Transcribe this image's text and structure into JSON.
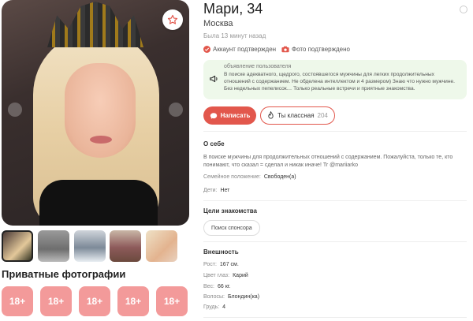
{
  "profile": {
    "name": "Мари, 34",
    "city": "Москва",
    "last_seen": "Была 13 минут назад",
    "badges": [
      {
        "label": "Аккаунт подтвержден",
        "color": "#e2574c"
      },
      {
        "label": "Фото подтверждено",
        "color": "#e2574c"
      }
    ]
  },
  "announcement": {
    "title": "объявление пользователя",
    "text": "В поиске адекватного, щедрого, состоявшегося мужчины для легких продолжительных отношений с содержанием. Не обделена интеллектом и 4 размером) Знаю что нужно мужчине. Без недельных пепелисок… Только реальные встречи и приятные знакомства."
  },
  "actions": {
    "write_label": "Написать",
    "like_label": "Ты классная",
    "like_count": "204"
  },
  "about": {
    "title": "О себе",
    "text": "В поиске мужчины для продолжительных отношений с содержанием. Пожалуйста, только те, кто понимают, что сказал = сделал и никак иначе! Tr @mariiarko",
    "family_label": "Семейное положение:",
    "family_value": "Свободен(а)",
    "kids_label": "Дети:",
    "kids_value": "Нет"
  },
  "goals": {
    "title": "Цели знакомства",
    "chip": "Поиск спонсора"
  },
  "appearance": {
    "title": "Внешность",
    "height_label": "Рост:",
    "height_value": "167 см.",
    "eyes_label": "Цвет глаз:",
    "eyes_value": "Карий",
    "weight_label": "Вес:",
    "weight_value": "66 кг.",
    "hair_label": "Волосы:",
    "hair_value": "Блондин(ка)",
    "chest_label": "Грудь:",
    "chest_value": "4"
  },
  "private": {
    "title": "Приватные фотографии",
    "tiles": [
      "18+",
      "18+",
      "18+",
      "18+",
      "18+"
    ]
  },
  "colors": {
    "accent": "#e2574c",
    "private_tile": "#f39a9a",
    "announce_bg": "#eef8ea"
  },
  "icons": {
    "favorite": "star-icon",
    "write": "chat-icon",
    "like": "flame-icon",
    "announce": "megaphone-icon",
    "verified": "check-circle-icon",
    "photo_verified": "camera-icon"
  }
}
